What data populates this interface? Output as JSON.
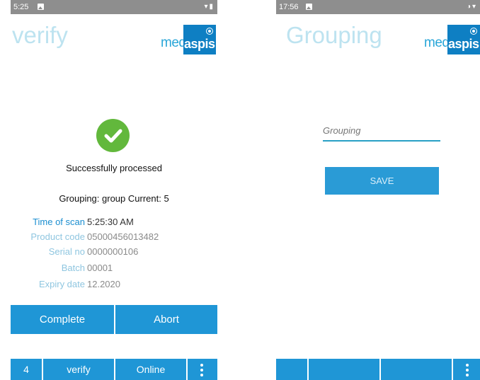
{
  "left_screen": {
    "status_bar": {
      "time": "5:25"
    },
    "title": "verify",
    "logo": {
      "med": "med",
      "aspis": "aspis"
    },
    "status_message": "Successfully processed",
    "grouping_line": "Grouping: group Current: 5",
    "details": [
      {
        "label": "Time of scan",
        "value": "5:25:30 AM"
      },
      {
        "label": "Product code",
        "value": "05000456013482"
      },
      {
        "label": "Serial no",
        "value": "0000000106"
      },
      {
        "label": "Batch",
        "value": "00001"
      },
      {
        "label": "Expiry date",
        "value": "12.2020"
      }
    ],
    "actions": {
      "complete": "Complete",
      "abort": "Abort"
    },
    "bottom_bar": {
      "count": "4",
      "mode": "verify",
      "connection": "Online"
    }
  },
  "right_screen": {
    "status_bar": {
      "time": "17:56"
    },
    "title": "Grouping",
    "logo": {
      "med": "med",
      "aspis": "aspis"
    },
    "grouping_input": {
      "placeholder": "Grouping",
      "value": ""
    },
    "save_label": "SAVE"
  },
  "colors": {
    "accent": "#1f96d6",
    "status_bar": "#8e8e8e",
    "title": "#bde3f0",
    "success": "#62b83c",
    "logo_box": "#0e7fc3"
  },
  "icons": [
    "gallery-icon",
    "wifi-icon",
    "battery-icon",
    "check-icon",
    "target-icon",
    "kebab-menu-icon"
  ]
}
